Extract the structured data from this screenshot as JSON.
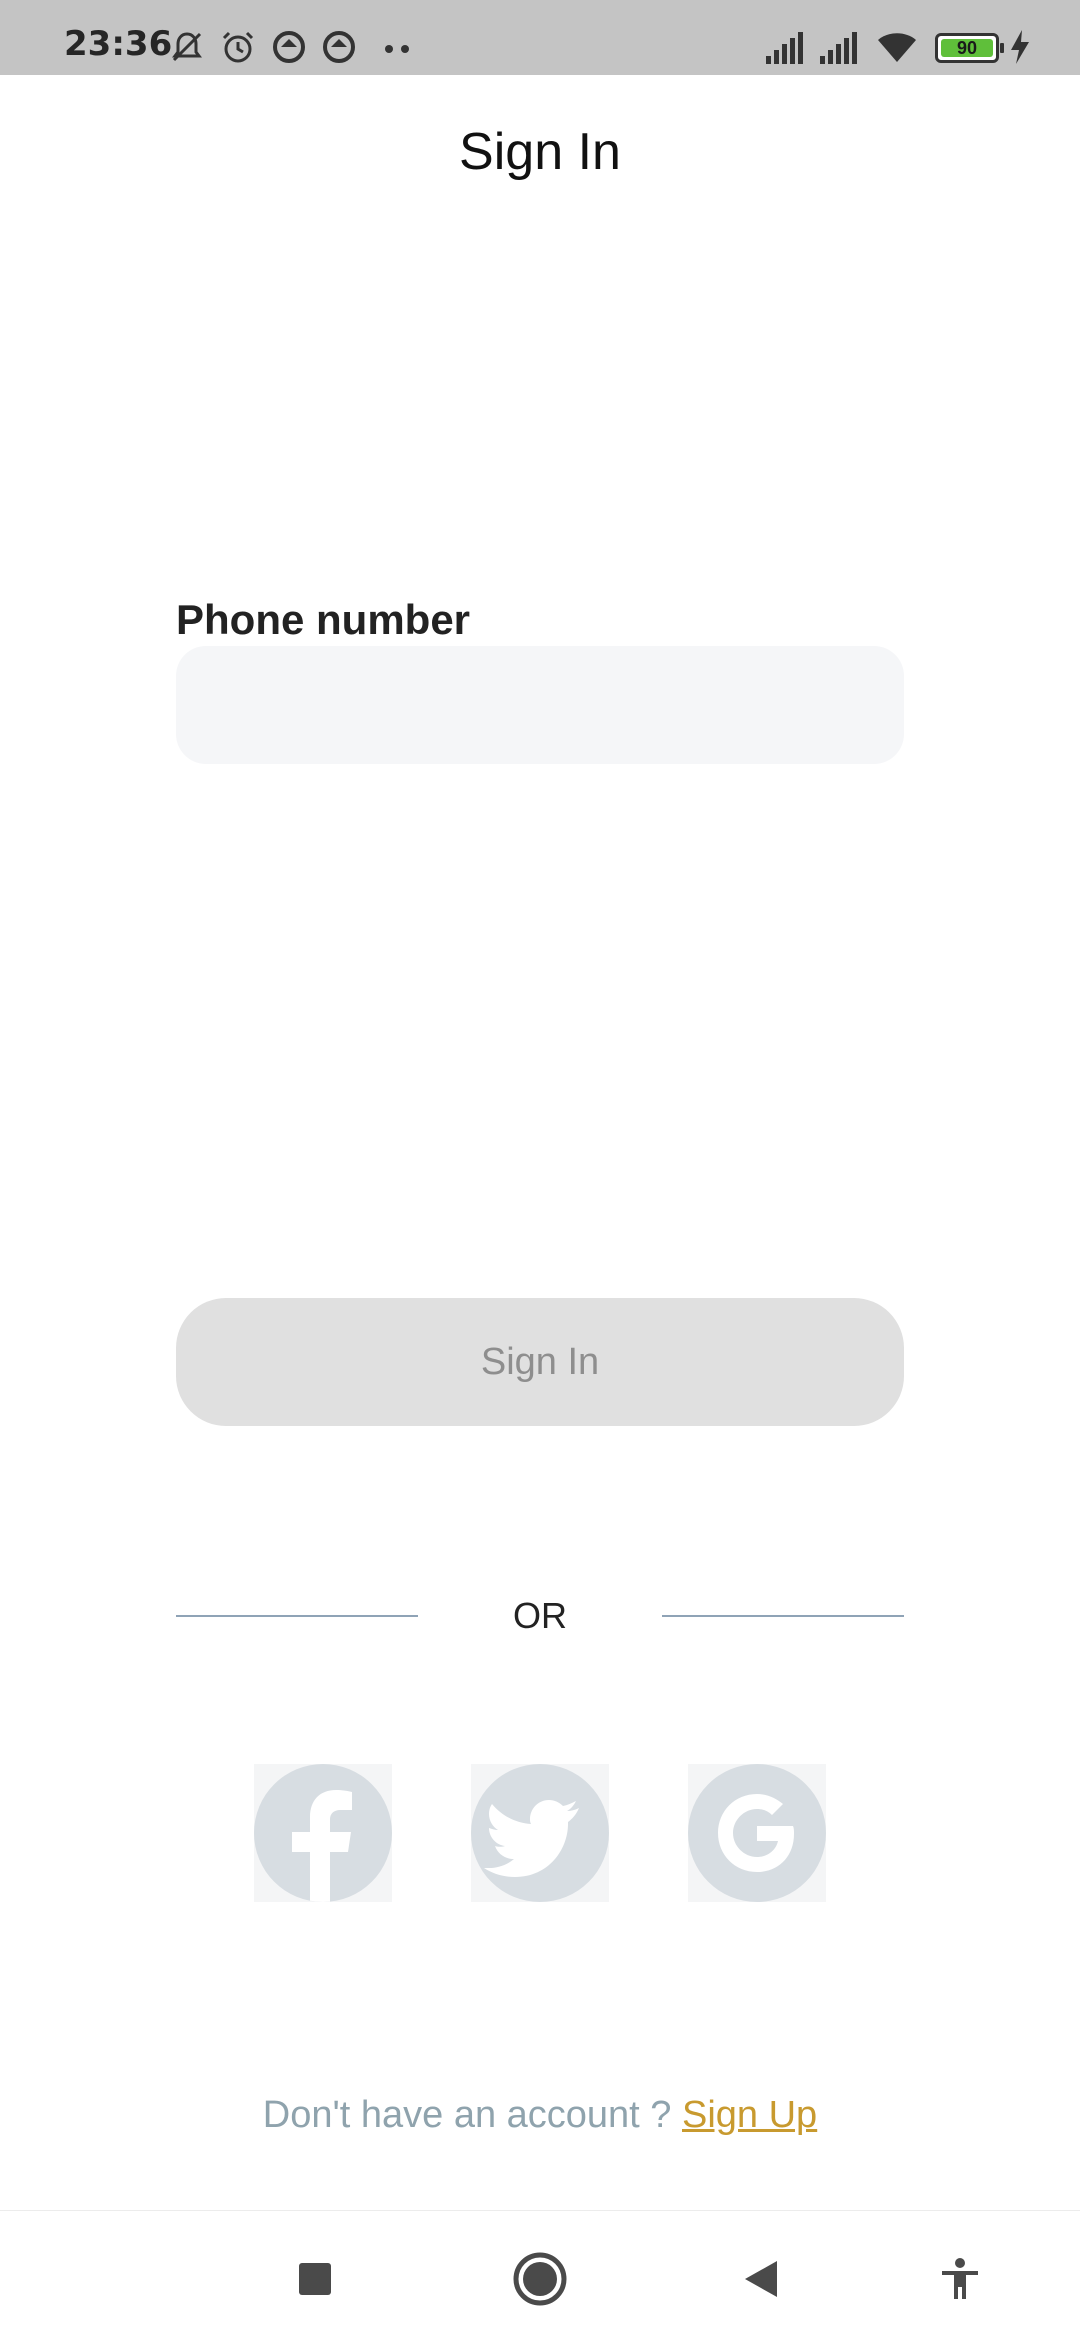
{
  "status_bar": {
    "time": "23:36",
    "battery_level": "90",
    "icons": [
      "mute-icon",
      "alarm-icon",
      "data-saver-icon",
      "data-saver-icon",
      "signal-icon",
      "signal-icon",
      "wifi-icon",
      "battery-icon",
      "charging-icon"
    ]
  },
  "header": {
    "title": "Sign In"
  },
  "form": {
    "phone_label": "Phone number",
    "phone_value": "",
    "phone_placeholder": ""
  },
  "actions": {
    "signin_label": "Sign In"
  },
  "divider": {
    "text": "OR"
  },
  "social": {
    "buttons": [
      "facebook-icon",
      "twitter-icon",
      "google-icon"
    ],
    "icon_color": "#d7dde2"
  },
  "footer": {
    "prompt": "Don't have an account ? ",
    "signup_label": "Sign Up",
    "link_color": "#c89a2f"
  },
  "nav": {
    "buttons": [
      "recents-button",
      "home-button",
      "back-button",
      "accessibility-button"
    ]
  }
}
